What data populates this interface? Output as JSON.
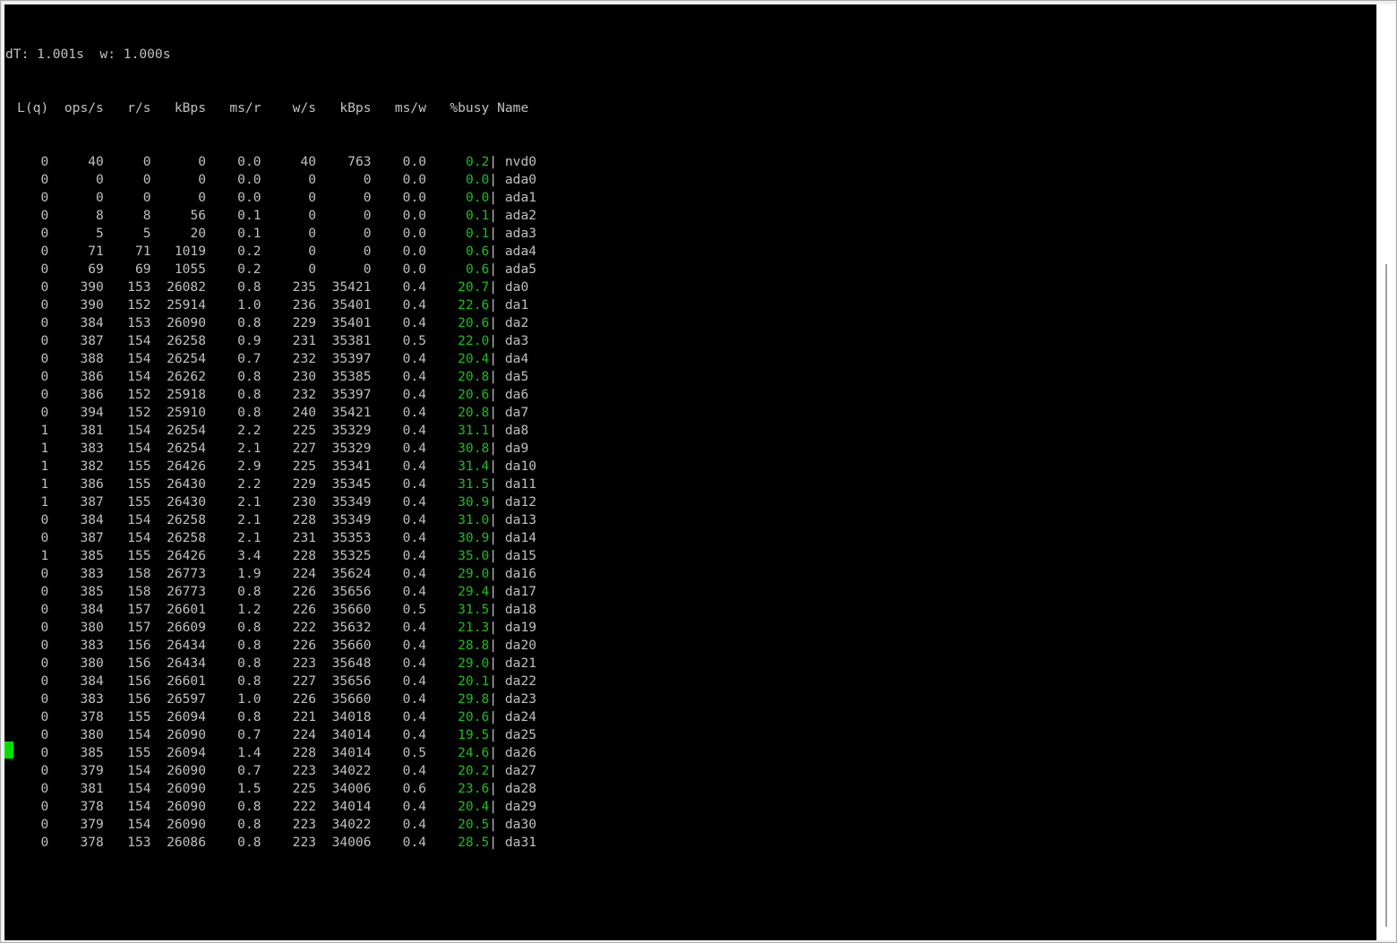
{
  "status_line": "dT: 1.001s  w: 1.000s",
  "headers": [
    "L(q)",
    "ops/s",
    "r/s",
    "kBps",
    "ms/r",
    "w/s",
    "kBps",
    "ms/w",
    "%busy",
    "Name"
  ],
  "rows": [
    [
      "0",
      "40",
      "0",
      "0",
      "0.0",
      "40",
      "763",
      "0.0",
      "0.2",
      "nvd0"
    ],
    [
      "0",
      "0",
      "0",
      "0",
      "0.0",
      "0",
      "0",
      "0.0",
      "0.0",
      "ada0"
    ],
    [
      "0",
      "0",
      "0",
      "0",
      "0.0",
      "0",
      "0",
      "0.0",
      "0.0",
      "ada1"
    ],
    [
      "0",
      "8",
      "8",
      "56",
      "0.1",
      "0",
      "0",
      "0.0",
      "0.1",
      "ada2"
    ],
    [
      "0",
      "5",
      "5",
      "20",
      "0.1",
      "0",
      "0",
      "0.0",
      "0.1",
      "ada3"
    ],
    [
      "0",
      "71",
      "71",
      "1019",
      "0.2",
      "0",
      "0",
      "0.0",
      "0.6",
      "ada4"
    ],
    [
      "0",
      "69",
      "69",
      "1055",
      "0.2",
      "0",
      "0",
      "0.0",
      "0.6",
      "ada5"
    ],
    [
      "0",
      "390",
      "153",
      "26082",
      "0.8",
      "235",
      "35421",
      "0.4",
      "20.7",
      "da0"
    ],
    [
      "0",
      "390",
      "152",
      "25914",
      "1.0",
      "236",
      "35401",
      "0.4",
      "22.6",
      "da1"
    ],
    [
      "0",
      "384",
      "153",
      "26090",
      "0.8",
      "229",
      "35401",
      "0.4",
      "20.6",
      "da2"
    ],
    [
      "0",
      "387",
      "154",
      "26258",
      "0.9",
      "231",
      "35381",
      "0.5",
      "22.0",
      "da3"
    ],
    [
      "0",
      "388",
      "154",
      "26254",
      "0.7",
      "232",
      "35397",
      "0.4",
      "20.4",
      "da4"
    ],
    [
      "0",
      "386",
      "154",
      "26262",
      "0.8",
      "230",
      "35385",
      "0.4",
      "20.8",
      "da5"
    ],
    [
      "0",
      "386",
      "152",
      "25918",
      "0.8",
      "232",
      "35397",
      "0.4",
      "20.6",
      "da6"
    ],
    [
      "0",
      "394",
      "152",
      "25910",
      "0.8",
      "240",
      "35421",
      "0.4",
      "20.8",
      "da7"
    ],
    [
      "1",
      "381",
      "154",
      "26254",
      "2.2",
      "225",
      "35329",
      "0.4",
      "31.1",
      "da8"
    ],
    [
      "1",
      "383",
      "154",
      "26254",
      "2.1",
      "227",
      "35329",
      "0.4",
      "30.8",
      "da9"
    ],
    [
      "1",
      "382",
      "155",
      "26426",
      "2.9",
      "225",
      "35341",
      "0.4",
      "31.4",
      "da10"
    ],
    [
      "1",
      "386",
      "155",
      "26430",
      "2.2",
      "229",
      "35345",
      "0.4",
      "31.5",
      "da11"
    ],
    [
      "1",
      "387",
      "155",
      "26430",
      "2.1",
      "230",
      "35349",
      "0.4",
      "30.9",
      "da12"
    ],
    [
      "0",
      "384",
      "154",
      "26258",
      "2.1",
      "228",
      "35349",
      "0.4",
      "31.0",
      "da13"
    ],
    [
      "0",
      "387",
      "154",
      "26258",
      "2.1",
      "231",
      "35353",
      "0.4",
      "30.9",
      "da14"
    ],
    [
      "1",
      "385",
      "155",
      "26426",
      "3.4",
      "228",
      "35325",
      "0.4",
      "35.0",
      "da15"
    ],
    [
      "0",
      "383",
      "158",
      "26773",
      "1.9",
      "224",
      "35624",
      "0.4",
      "29.0",
      "da16"
    ],
    [
      "0",
      "385",
      "158",
      "26773",
      "0.8",
      "226",
      "35656",
      "0.4",
      "29.4",
      "da17"
    ],
    [
      "0",
      "384",
      "157",
      "26601",
      "1.2",
      "226",
      "35660",
      "0.5",
      "31.5",
      "da18"
    ],
    [
      "0",
      "380",
      "157",
      "26609",
      "0.8",
      "222",
      "35632",
      "0.4",
      "21.3",
      "da19"
    ],
    [
      "0",
      "383",
      "156",
      "26434",
      "0.8",
      "226",
      "35660",
      "0.4",
      "28.8",
      "da20"
    ],
    [
      "0",
      "380",
      "156",
      "26434",
      "0.8",
      "223",
      "35648",
      "0.4",
      "29.0",
      "da21"
    ],
    [
      "0",
      "384",
      "156",
      "26601",
      "0.8",
      "227",
      "35656",
      "0.4",
      "20.1",
      "da22"
    ],
    [
      "0",
      "383",
      "156",
      "26597",
      "1.0",
      "226",
      "35660",
      "0.4",
      "29.8",
      "da23"
    ],
    [
      "0",
      "378",
      "155",
      "26094",
      "0.8",
      "221",
      "34018",
      "0.4",
      "20.6",
      "da24"
    ],
    [
      "0",
      "380",
      "154",
      "26090",
      "0.7",
      "224",
      "34014",
      "0.4",
      "19.5",
      "da25"
    ],
    [
      "0",
      "385",
      "155",
      "26094",
      "1.4",
      "228",
      "34014",
      "0.5",
      "24.6",
      "da26"
    ],
    [
      "0",
      "379",
      "154",
      "26090",
      "0.7",
      "223",
      "34022",
      "0.4",
      "20.2",
      "da27"
    ],
    [
      "0",
      "381",
      "154",
      "26090",
      "1.5",
      "225",
      "34006",
      "0.6",
      "23.6",
      "da28"
    ],
    [
      "0",
      "378",
      "154",
      "26090",
      "0.8",
      "222",
      "34014",
      "0.4",
      "20.4",
      "da29"
    ],
    [
      "0",
      "379",
      "154",
      "26090",
      "0.8",
      "223",
      "34022",
      "0.4",
      "20.5",
      "da30"
    ],
    [
      "0",
      "378",
      "153",
      "26086",
      "0.8",
      "223",
      "34006",
      "0.4",
      "28.5",
      "da31"
    ]
  ],
  "colors": {
    "background": "#000000",
    "text": "#c0c0c0",
    "busy": "#1bbf1b",
    "cursor": "#00e000"
  }
}
